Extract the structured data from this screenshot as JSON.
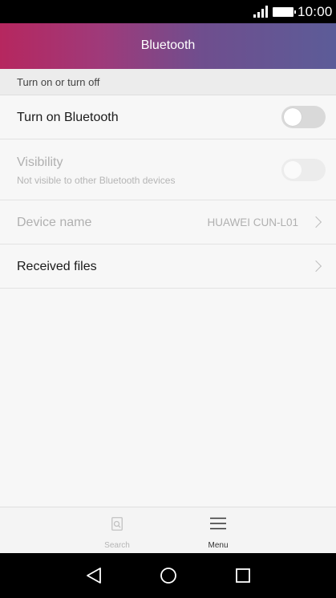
{
  "status_bar": {
    "time": "10:00"
  },
  "header": {
    "title": "Bluetooth"
  },
  "section": {
    "title": "Turn on or turn off"
  },
  "rows": {
    "bluetooth": {
      "label": "Turn on Bluetooth",
      "state": "off"
    },
    "visibility": {
      "label": "Visibility",
      "sublabel": "Not visible to other Bluetooth devices",
      "state": "off",
      "enabled": false
    },
    "device_name": {
      "label": "Device name",
      "value": "HUAWEI CUN-L01",
      "enabled": false
    },
    "received_files": {
      "label": "Received files"
    }
  },
  "bottom_bar": {
    "search_label": "Search",
    "menu_label": "Menu"
  },
  "icons": {
    "signal": "signal-icon",
    "battery": "battery-icon",
    "chevron": "chevron-right-icon",
    "search": "search-icon",
    "menu": "menu-icon",
    "back": "back-icon",
    "home": "home-icon",
    "recents": "recents-icon"
  },
  "colors": {
    "header_start": "#b6275f",
    "header_end": "#5c5c98",
    "toggle_off": "#d9d9d9"
  }
}
